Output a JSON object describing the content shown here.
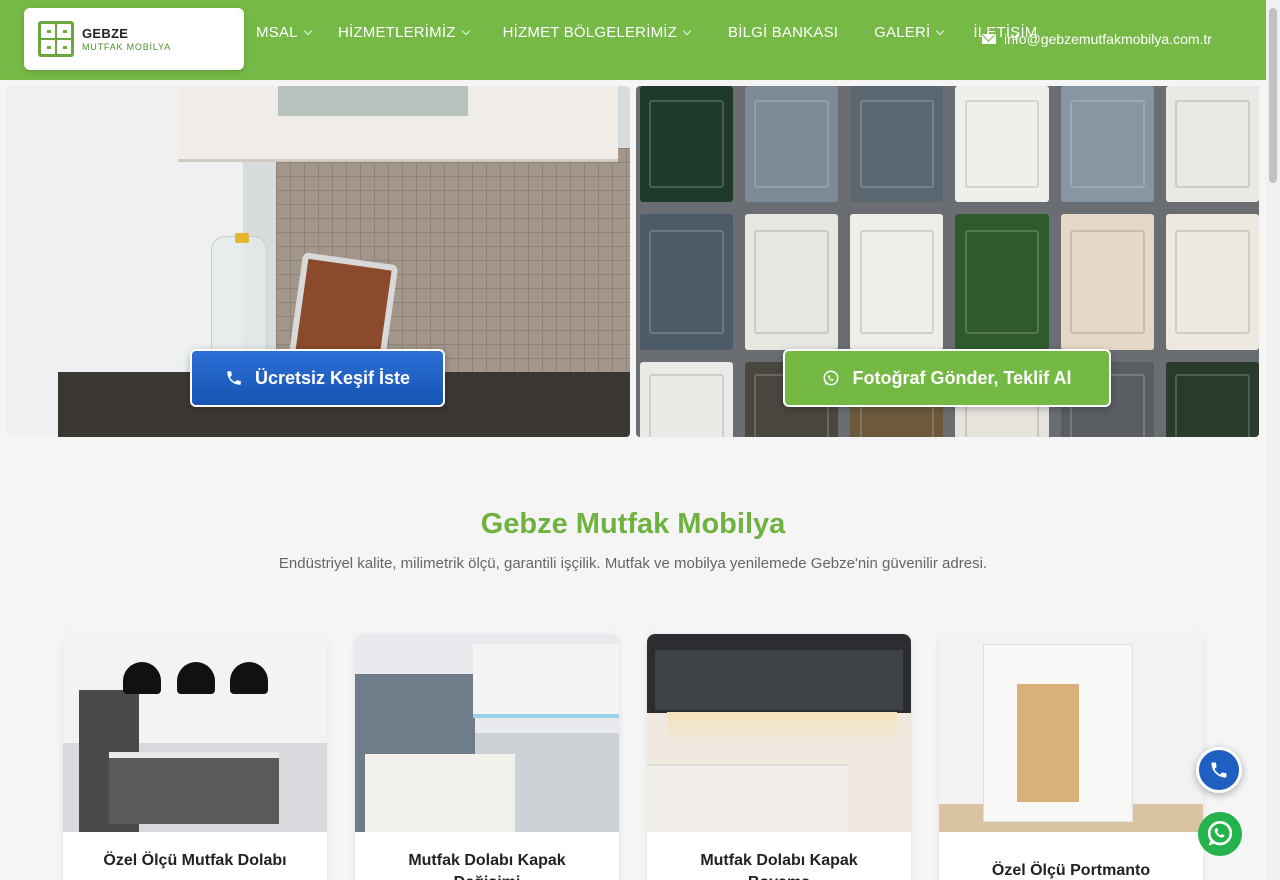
{
  "brand": {
    "title": "GEBZE",
    "subtitle": "MUTFAK MOBİLYA"
  },
  "nav": [
    {
      "label": "KURUMSAL",
      "has_dropdown": true,
      "visible_text": "MSAL"
    },
    {
      "label": "HİZMETLERİMİZ",
      "has_dropdown": true
    },
    {
      "label": "HİZMET BÖLGELERİMİZ",
      "has_dropdown": true
    },
    {
      "label": "BİLGİ BANKASI",
      "has_dropdown": false
    },
    {
      "label": "GALERİ",
      "has_dropdown": true
    },
    {
      "label": "İLETİŞİM",
      "has_dropdown": false
    }
  ],
  "contact": {
    "email": "info@gebzemutfakmobilya.com.tr",
    "icon": "envelope-icon"
  },
  "hero": {
    "left_cta": {
      "label": "Ücretsiz Keşif İste",
      "icon": "phone-icon"
    },
    "right_cta": {
      "label": "Fotoğraf Gönder, Teklif Al",
      "icon": "whatsapp-icon"
    }
  },
  "section": {
    "title": "Gebze Mutfak Mobilya",
    "subtitle": "Endüstriyel kalite, milimetrik ölçü, garantili işçilik. Mutfak ve mobilya yenilemede Gebze'nin güvenilir adresi."
  },
  "cards": [
    {
      "title": "Özel Ölçü Mutfak Dolabı"
    },
    {
      "title": "Mutfak Dolabı Kapak Değişimi"
    },
    {
      "title": "Mutfak Dolabı Kapak Boyama"
    },
    {
      "title": "Özel Ölçü Portmanto"
    }
  ],
  "floating": {
    "phone_icon": "phone-icon",
    "whatsapp_icon": "whatsapp-icon"
  },
  "colors": {
    "brand_green": "#76b947",
    "cta_blue": "#1f5fc2",
    "whatsapp_green": "#25b24a"
  }
}
